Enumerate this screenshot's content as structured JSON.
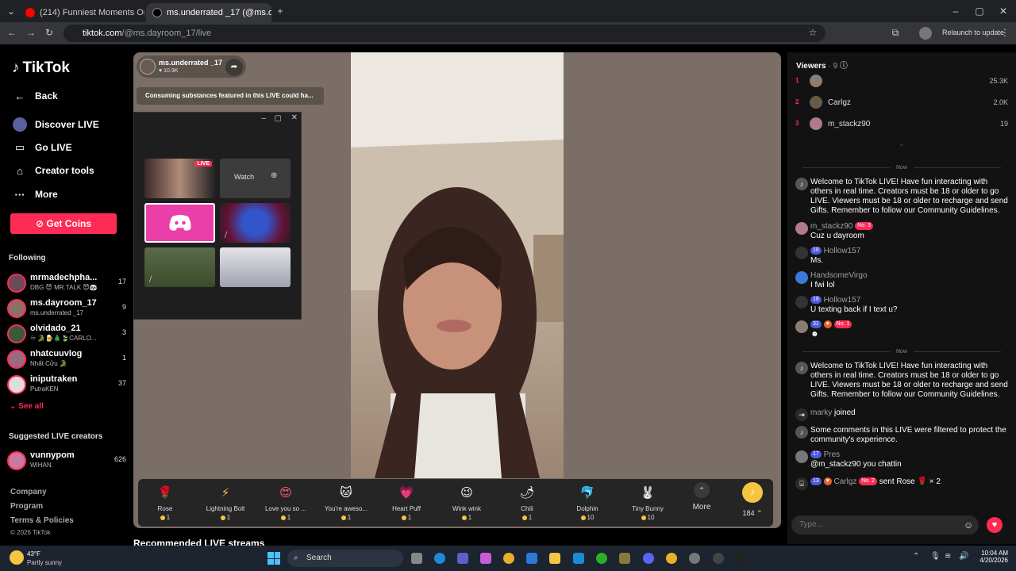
{
  "browser": {
    "tabs": [
      {
        "title": "(214) Funniest Moments On Po"
      },
      {
        "title": "ms.underrated _17 (@ms.da"
      }
    ],
    "url_host": "tiktok.com",
    "url_path": "/@ms.dayroom_17/live",
    "relaunch_label": "Relaunch to update"
  },
  "sidebar": {
    "logo": "TikTok",
    "back": "Back",
    "nav": [
      "Discover LIVE",
      "Go LIVE",
      "Creator tools",
      "More"
    ],
    "coins": "Get Coins",
    "following_head": "Following",
    "following": [
      {
        "name": "mrmadechpha...",
        "sub": "DBG 😈 MR.TALK 😈🐼",
        "count": "17"
      },
      {
        "name": "ms.dayroom_17",
        "sub": "ms.underrated _17",
        "count": "9"
      },
      {
        "name": "olvidado_21",
        "sub": "♾ 🐊🍺🎄🍃CARLO...",
        "count": "3"
      },
      {
        "name": "nhatcuuvlog",
        "sub": "Nhất Cửu 🐊",
        "count": "1"
      },
      {
        "name": "iniputraken",
        "sub": "PutraKEN",
        "count": "37"
      }
    ],
    "see_all": "See all",
    "suggested_head": "Suggested LIVE creators",
    "suggested": {
      "name": "vunnypom",
      "sub": "WIHAN.",
      "count": "626"
    },
    "footer": [
      "Company",
      "Program",
      "Terms & Policies",
      "© 2026 TikTok"
    ]
  },
  "stage": {
    "host_name": "ms.underrated _17",
    "host_likes": "♥ 10.9K",
    "warning": "Consuming substances featured in this LIVE could ha...",
    "recommended": "Recommended LIVE streams"
  },
  "popup": {
    "live_label": "LIVE",
    "watch_label": "Watch"
  },
  "gifts": [
    {
      "name": "Rose",
      "price": "1",
      "icon": "🌹",
      "color": "#fe2c55"
    },
    {
      "name": "Lightning Bolt",
      "price": "1",
      "icon": "⚡",
      "color": "#f5c542"
    },
    {
      "name": "Love you so ...",
      "price": "1",
      "icon": "😍",
      "color": "#ff5e7e"
    },
    {
      "name": "You're aweso...",
      "price": "1",
      "icon": "🐱",
      "color": "#c9a57a"
    },
    {
      "name": "Heart Puff",
      "price": "1",
      "icon": "💗",
      "color": "#f2a2c8"
    },
    {
      "name": "Wink wink",
      "price": "1",
      "icon": "😉",
      "color": "#e85aa8"
    },
    {
      "name": "Chili",
      "price": "1",
      "icon": "🌶",
      "color": "#e8342a"
    },
    {
      "name": "Dolphin",
      "price": "10",
      "icon": "🐬",
      "color": "#4aa3d8"
    },
    {
      "name": "Tiny Bunny",
      "price": "10",
      "icon": "🐰",
      "color": "#8bd47a"
    }
  ],
  "gift_more": "More",
  "coin_balance": "184",
  "viewers": {
    "label": "Viewers",
    "count": "· 9",
    "list": [
      {
        "rank": "1",
        "name": "",
        "count": "25.3K"
      },
      {
        "rank": "2",
        "name": "Carlgz",
        "count": "2.0K"
      },
      {
        "rank": "3",
        "name": "m_stackz90",
        "count": "19"
      }
    ]
  },
  "chat": {
    "now": "Now",
    "welcome": "Welcome to TikTok LIVE! Have fun interacting with others in real time. Creators must be 18 or older to go LIVE. Viewers must be 18 or older to recharge and send Gifts. Remember to follow our Community Guidelines.",
    "messages": [
      {
        "user": "m_stackz90",
        "badge": "No. 3",
        "text": "Cuz u dayroom"
      },
      {
        "user": "Hollow157",
        "badge": "18",
        "text": "Ms."
      },
      {
        "user": "HandsomeVirgo",
        "badge": "",
        "text": "I fwi lol"
      },
      {
        "user": "Hollow157",
        "badge": "18",
        "text": "U texting back if I text u?"
      },
      {
        "user": "",
        "badge": "31",
        "badge2": "No. 1",
        "text": ""
      }
    ],
    "joined_user": "marky",
    "joined_text": "joined",
    "filtered": "Some comments in this LIVE were filtered to protect the community's experience.",
    "pres_user": "Pres",
    "pres_badge": "17",
    "pres_text": "@m_stackz90 you chattin",
    "gift_user": "Carlgz",
    "gift_badge": "13",
    "gift_badge2": "No. 2",
    "gift_text": "sent Rose 🌹 × 2",
    "placeholder": "Type..."
  },
  "taskbar": {
    "weather_temp": "43°F",
    "weather_desc": "Partly sunny",
    "search": "Search",
    "time": "10:04 AM",
    "date": "4/20/2026"
  }
}
